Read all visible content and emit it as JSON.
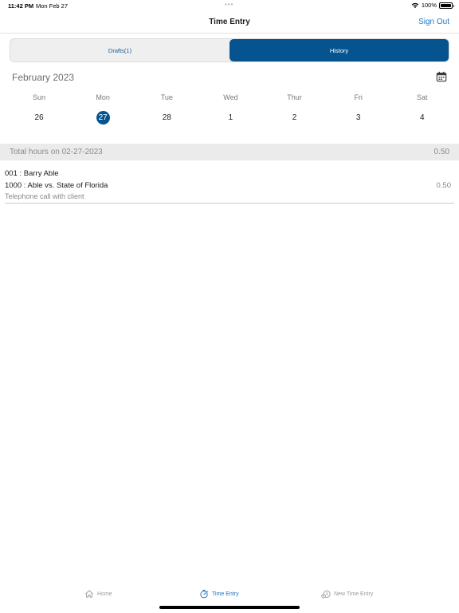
{
  "status_bar": {
    "time": "11:42 PM",
    "date": "Mon Feb 27",
    "dots": "•••",
    "battery": "100%"
  },
  "nav": {
    "title": "Time Entry",
    "sign_out": "Sign Out"
  },
  "segments": [
    {
      "label": "Drafts(1)",
      "active": false
    },
    {
      "label": "History",
      "active": true
    }
  ],
  "calendar": {
    "month": "February 2023",
    "weekdays": [
      "Sun",
      "Mon",
      "Tue",
      "Wed",
      "Thur",
      "Fri",
      "Sat"
    ],
    "dates": [
      "26",
      "27",
      "28",
      "1",
      "2",
      "3",
      "4"
    ],
    "selected": "27"
  },
  "total": {
    "label": "Total hours on 02-27-2023",
    "value": "0.50"
  },
  "entries": [
    {
      "client": "001 : Barry Able",
      "matter": "1000 : Able vs. State of Florida",
      "description": "Telephone call with client",
      "hours": "0.50"
    }
  ],
  "tabs": [
    {
      "label": "Home",
      "icon": "home-icon",
      "active": false
    },
    {
      "label": "Time Entry",
      "icon": "stopwatch-icon",
      "active": true
    },
    {
      "label": "New Time Entry",
      "icon": "new-time-entry-icon",
      "active": false
    }
  ],
  "colors": {
    "accent": "#06548f",
    "link": "#1d79c9",
    "tab_active": "#1d6fb6"
  }
}
